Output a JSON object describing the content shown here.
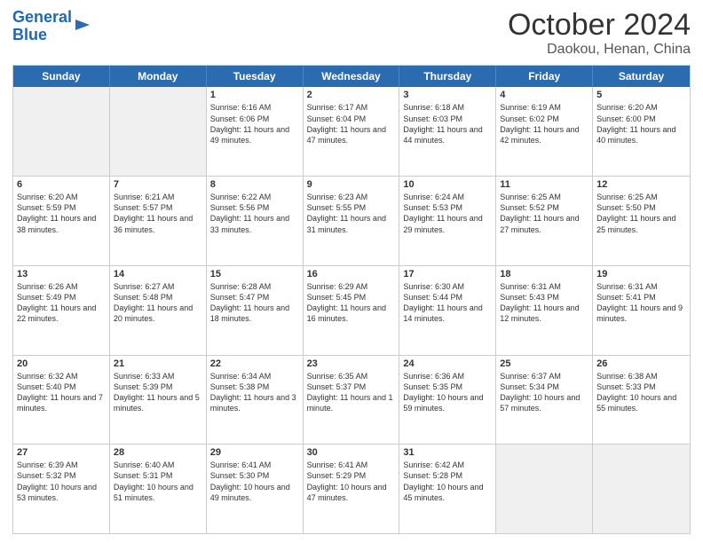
{
  "header": {
    "logo_line1": "General",
    "logo_line2": "Blue",
    "title": "October 2024",
    "subtitle": "Daokou, Henan, China"
  },
  "weekdays": [
    "Sunday",
    "Monday",
    "Tuesday",
    "Wednesday",
    "Thursday",
    "Friday",
    "Saturday"
  ],
  "weeks": [
    [
      {
        "day": "",
        "text": "",
        "shaded": true
      },
      {
        "day": "",
        "text": "",
        "shaded": true
      },
      {
        "day": "1",
        "text": "Sunrise: 6:16 AM\nSunset: 6:06 PM\nDaylight: 11 hours and 49 minutes."
      },
      {
        "day": "2",
        "text": "Sunrise: 6:17 AM\nSunset: 6:04 PM\nDaylight: 11 hours and 47 minutes."
      },
      {
        "day": "3",
        "text": "Sunrise: 6:18 AM\nSunset: 6:03 PM\nDaylight: 11 hours and 44 minutes."
      },
      {
        "day": "4",
        "text": "Sunrise: 6:19 AM\nSunset: 6:02 PM\nDaylight: 11 hours and 42 minutes."
      },
      {
        "day": "5",
        "text": "Sunrise: 6:20 AM\nSunset: 6:00 PM\nDaylight: 11 hours and 40 minutes."
      }
    ],
    [
      {
        "day": "6",
        "text": "Sunrise: 6:20 AM\nSunset: 5:59 PM\nDaylight: 11 hours and 38 minutes."
      },
      {
        "day": "7",
        "text": "Sunrise: 6:21 AM\nSunset: 5:57 PM\nDaylight: 11 hours and 36 minutes."
      },
      {
        "day": "8",
        "text": "Sunrise: 6:22 AM\nSunset: 5:56 PM\nDaylight: 11 hours and 33 minutes."
      },
      {
        "day": "9",
        "text": "Sunrise: 6:23 AM\nSunset: 5:55 PM\nDaylight: 11 hours and 31 minutes."
      },
      {
        "day": "10",
        "text": "Sunrise: 6:24 AM\nSunset: 5:53 PM\nDaylight: 11 hours and 29 minutes."
      },
      {
        "day": "11",
        "text": "Sunrise: 6:25 AM\nSunset: 5:52 PM\nDaylight: 11 hours and 27 minutes."
      },
      {
        "day": "12",
        "text": "Sunrise: 6:25 AM\nSunset: 5:50 PM\nDaylight: 11 hours and 25 minutes."
      }
    ],
    [
      {
        "day": "13",
        "text": "Sunrise: 6:26 AM\nSunset: 5:49 PM\nDaylight: 11 hours and 22 minutes."
      },
      {
        "day": "14",
        "text": "Sunrise: 6:27 AM\nSunset: 5:48 PM\nDaylight: 11 hours and 20 minutes."
      },
      {
        "day": "15",
        "text": "Sunrise: 6:28 AM\nSunset: 5:47 PM\nDaylight: 11 hours and 18 minutes."
      },
      {
        "day": "16",
        "text": "Sunrise: 6:29 AM\nSunset: 5:45 PM\nDaylight: 11 hours and 16 minutes."
      },
      {
        "day": "17",
        "text": "Sunrise: 6:30 AM\nSunset: 5:44 PM\nDaylight: 11 hours and 14 minutes."
      },
      {
        "day": "18",
        "text": "Sunrise: 6:31 AM\nSunset: 5:43 PM\nDaylight: 11 hours and 12 minutes."
      },
      {
        "day": "19",
        "text": "Sunrise: 6:31 AM\nSunset: 5:41 PM\nDaylight: 11 hours and 9 minutes."
      }
    ],
    [
      {
        "day": "20",
        "text": "Sunrise: 6:32 AM\nSunset: 5:40 PM\nDaylight: 11 hours and 7 minutes."
      },
      {
        "day": "21",
        "text": "Sunrise: 6:33 AM\nSunset: 5:39 PM\nDaylight: 11 hours and 5 minutes."
      },
      {
        "day": "22",
        "text": "Sunrise: 6:34 AM\nSunset: 5:38 PM\nDaylight: 11 hours and 3 minutes."
      },
      {
        "day": "23",
        "text": "Sunrise: 6:35 AM\nSunset: 5:37 PM\nDaylight: 11 hours and 1 minute."
      },
      {
        "day": "24",
        "text": "Sunrise: 6:36 AM\nSunset: 5:35 PM\nDaylight: 10 hours and 59 minutes."
      },
      {
        "day": "25",
        "text": "Sunrise: 6:37 AM\nSunset: 5:34 PM\nDaylight: 10 hours and 57 minutes."
      },
      {
        "day": "26",
        "text": "Sunrise: 6:38 AM\nSunset: 5:33 PM\nDaylight: 10 hours and 55 minutes."
      }
    ],
    [
      {
        "day": "27",
        "text": "Sunrise: 6:39 AM\nSunset: 5:32 PM\nDaylight: 10 hours and 53 minutes."
      },
      {
        "day": "28",
        "text": "Sunrise: 6:40 AM\nSunset: 5:31 PM\nDaylight: 10 hours and 51 minutes."
      },
      {
        "day": "29",
        "text": "Sunrise: 6:41 AM\nSunset: 5:30 PM\nDaylight: 10 hours and 49 minutes."
      },
      {
        "day": "30",
        "text": "Sunrise: 6:41 AM\nSunset: 5:29 PM\nDaylight: 10 hours and 47 minutes."
      },
      {
        "day": "31",
        "text": "Sunrise: 6:42 AM\nSunset: 5:28 PM\nDaylight: 10 hours and 45 minutes."
      },
      {
        "day": "",
        "text": "",
        "shaded": true
      },
      {
        "day": "",
        "text": "",
        "shaded": true
      }
    ]
  ]
}
